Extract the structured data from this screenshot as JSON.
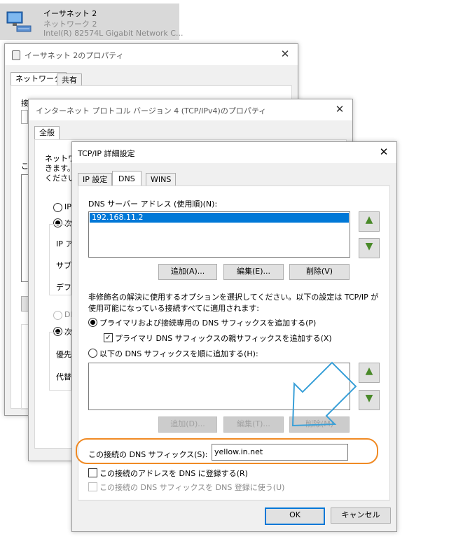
{
  "adapter_card": {
    "name": "イーサネット 2",
    "network": "ネットワーク 2",
    "device": "Intel(R) 82574L Gigabit Network C..."
  },
  "eth_props": {
    "title": "イーサネット 2のプロパティ",
    "tabs": [
      "ネットワーク",
      "共有"
    ],
    "connect_label_partial": "接続の方法",
    "items_label_partial": "この",
    "checkbox_partial": "終"
  },
  "ipv4_props": {
    "title": "インターネット プロトコル バージョン 4 (TCP/IPv4)のプロパティ",
    "tabs": [
      "全般"
    ],
    "desc_partial_1": "ネットワー",
    "desc_partial_2": "きます。",
    "desc_partial_3": "ください。",
    "radio_ip_partial": "IP",
    "radio_next_partial": "次",
    "ip_label_partial": "IP ア",
    "subnet_label_partial": "サブ",
    "gateway_label_partial": "デフ",
    "dns_auto_partial": "DN",
    "dns_next_partial": "次",
    "preferred_partial": "優先",
    "alternate_partial": "代替"
  },
  "advanced": {
    "title": "TCP/IP 詳細設定",
    "close": "✕",
    "tabs": [
      "IP 設定",
      "DNS",
      "WINS"
    ],
    "dns_servers_label": "DNS サーバー アドレス (使用順)(N):",
    "dns_servers": [
      "192.168.11.2"
    ],
    "buttons_top": [
      "追加(A)...",
      "編集(E)...",
      "削除(V)"
    ],
    "description_line1": "非修飾名の解決に使用するオプションを選択してください。以下の設定は TCP/IP が",
    "description_line2": "使用可能になっている接続すべてに適用されます:",
    "radio_primary": "プライマリおよび接続専用の DNS サフィックスを追加する(P)",
    "check_parent": "プライマリ DNS サフィックスの親サフィックスを追加する(X)",
    "radio_list": "以下の DNS サフィックスを順に追加する(H):",
    "buttons_bottom": [
      "追加(D)...",
      "編集(T)...",
      "削除(M)"
    ],
    "suffix_label": "この接続の DNS サフィックス(S):",
    "suffix_value": "yellow.in.net",
    "check_register": "この接続のアドレスを DNS に登録する(R)",
    "check_use_suffix": "この接続の DNS サフィックスを DNS 登録に使う(U)",
    "ok": "OK",
    "cancel": "キャンセル"
  },
  "colors": {
    "highlight_orange": "#f08a24",
    "arrow_blue": "#3aa0d8",
    "selection_blue": "#0078d7"
  },
  "icons": {
    "arrow_up": "▲",
    "arrow_down": "▼",
    "check": "✓"
  }
}
